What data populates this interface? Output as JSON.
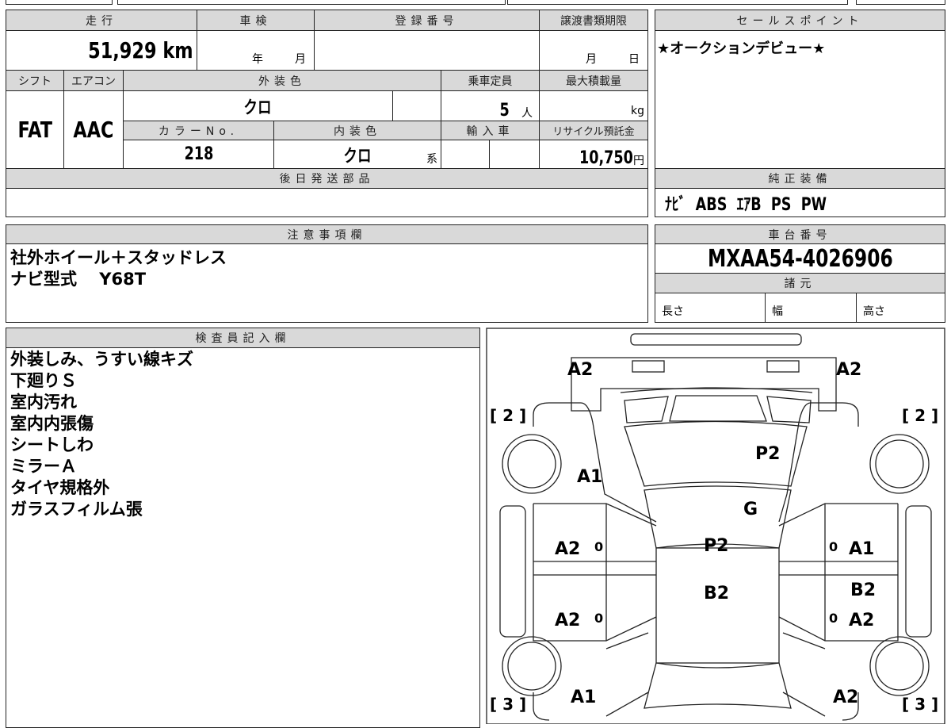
{
  "vehicle_info": {
    "mileage_label": "走行",
    "mileage": "51,929 km",
    "inspection_label": "車検",
    "inspection_year": "年",
    "inspection_month": "月",
    "registration_label": "登録番号",
    "transfer_deadline_label": "譲渡書類期限",
    "transfer_month": "月",
    "transfer_day": "日",
    "shift_label": "シフト",
    "shift": "FAT",
    "aircon_label": "エアコン",
    "aircon": "AAC",
    "exterior_color_label": "外装色",
    "exterior_color": "クロ",
    "capacity_label": "乗車定員",
    "capacity": "5",
    "capacity_unit": "人",
    "max_load_label": "最大積載量",
    "max_load_unit": "kg",
    "color_no_label": "カラーNo.",
    "color_no": "218",
    "interior_color_label": "内装色",
    "interior_color": "クロ",
    "interior_suffix": "系",
    "import_label": "輸入車",
    "recycle_label": "リサイクル預託金",
    "recycle_fee": "10,750",
    "recycle_unit": "円",
    "later_parts_label": "後日発送部品"
  },
  "sales_point": {
    "label": "セールスポイント",
    "text": "★オークションデビュー★"
  },
  "equipment": {
    "label": "純正装備",
    "text": "ﾅﾋﾞ  ABS  ｴｱB  PS  PW"
  },
  "notes": {
    "label": "注意事項欄",
    "lines": "社外ホイール＋スタッドレス\nナビ型式　 Y68T"
  },
  "chassis": {
    "label": "車台番号",
    "number": "MXAA54-4026906",
    "specs_label": "諸元",
    "length": "長さ",
    "width": "幅",
    "height": "高さ"
  },
  "inspector": {
    "label": "検査員記入欄",
    "lines": "外装しみ、うすい線キズ\n下廻りＳ\n室内汚れ\n室内内張傷\nシートしわ\nミラーＡ\nタイヤ規格外\nガラスフィルム張"
  },
  "diagram": {
    "marks": {
      "front_left": "A2",
      "front_right": "A2",
      "hood": "P2",
      "left_front_fender": "A1",
      "windshield": "G",
      "roof": "P2",
      "left_front_door": "A2",
      "right_front_door": "A1",
      "roof_rear": "B2",
      "right_rear_door": "B2",
      "left_rear_door": "A2",
      "right_rear_door_low": "A2",
      "left_rear_fender": "A1",
      "right_rear_fender": "A2"
    },
    "tire_front_left": "[ 2 ]",
    "tire_front_right": "[ 2 ]",
    "tire_rear_left": "[ 3 ]",
    "tire_rear_right": "[ 3 ]",
    "mirror_mark": "0"
  }
}
